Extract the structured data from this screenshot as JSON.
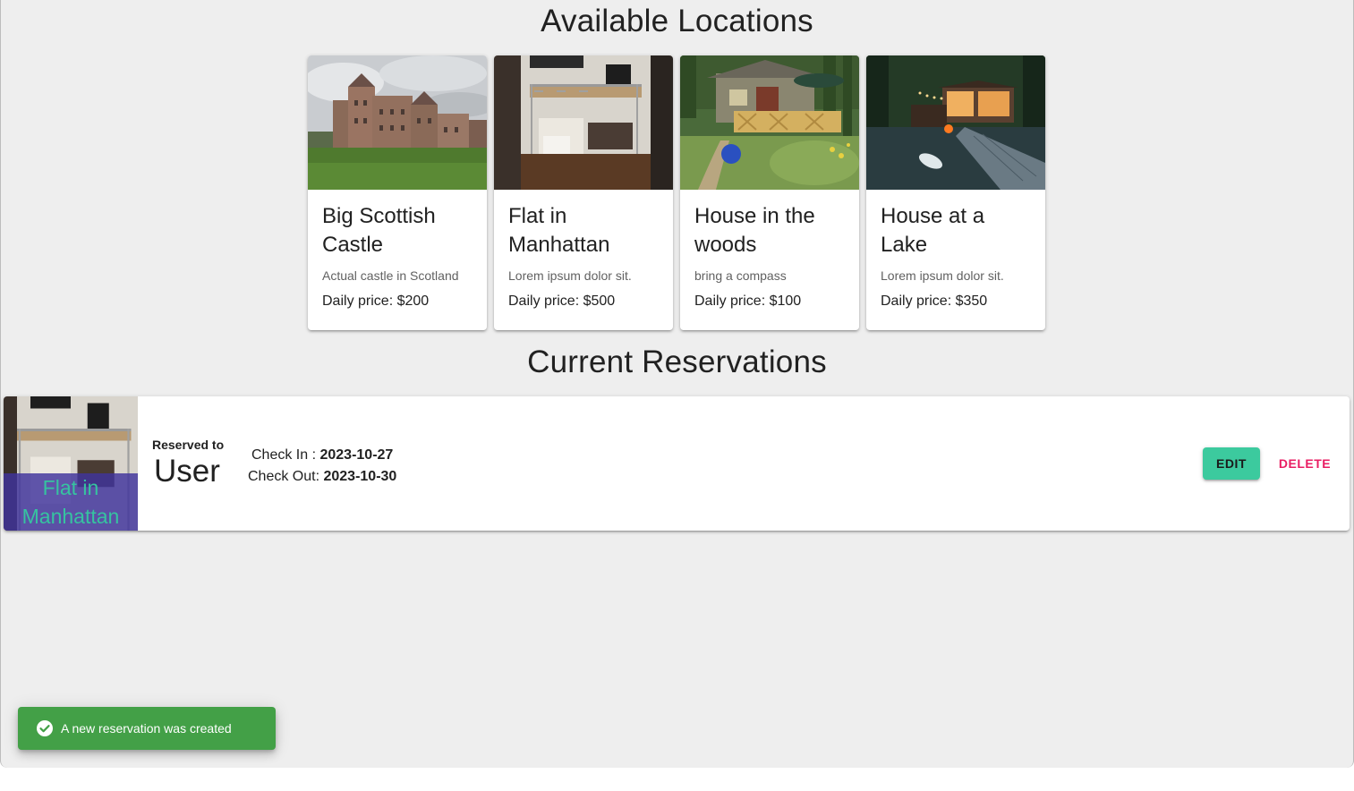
{
  "headings": {
    "available": "Available Locations",
    "reservations": "Current Reservations"
  },
  "locations": [
    {
      "title": "Big Scottish Castle",
      "description": "Actual castle in Scotland",
      "price": "Daily price: $200",
      "image": "castle-photo"
    },
    {
      "title": "Flat in Manhattan",
      "description": "Lorem ipsum dolor sit.",
      "price": "Daily price: $500",
      "image": "flat-photo"
    },
    {
      "title": "House in the woods",
      "description": "bring a compass",
      "price": "Daily price: $100",
      "image": "cabin-photo"
    },
    {
      "title": "House at a Lake",
      "description": "Lorem ipsum dolor sit.",
      "price": "Daily price: $350",
      "image": "lake-house-photo"
    }
  ],
  "reservation": {
    "location": "Flat in Manhattan",
    "reserved_label": "Reserved to",
    "user": "User",
    "check_in_label": "Check In : ",
    "check_in": "2023-10-27",
    "check_out_label": "Check Out: ",
    "check_out": "2023-10-30",
    "edit_label": "EDIT",
    "delete_label": "DELETE"
  },
  "snackbar": {
    "message": "A new reservation was created",
    "icon": "check-circle-icon"
  },
  "colors": {
    "edit_button": "#3cca9e",
    "delete_text": "#e91e63",
    "snackbar": "#43a047",
    "overlay": "#3f339c",
    "overlay_text": "#36c3a0"
  }
}
